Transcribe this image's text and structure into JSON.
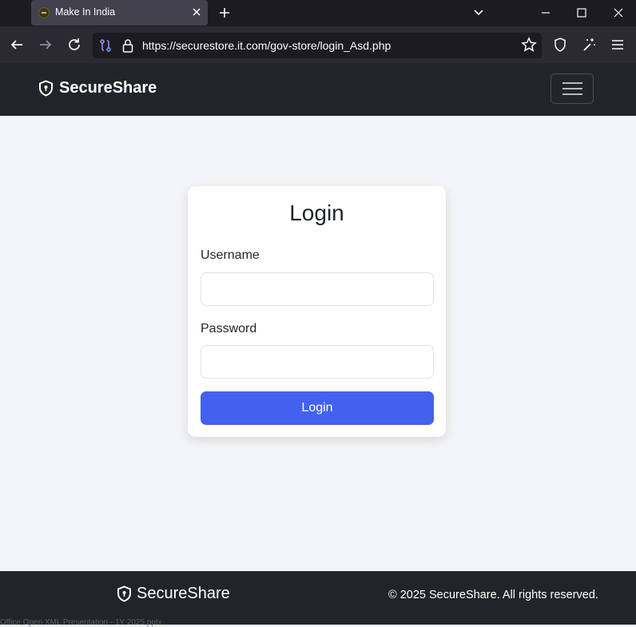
{
  "browser": {
    "tab_title": "Make In India",
    "url": "https://securestore.it.com/gov-store/login_Asd.php"
  },
  "header": {
    "brand": "SecureShare"
  },
  "login": {
    "title": "Login",
    "username_label": "Username",
    "username_value": "",
    "password_label": "Password",
    "password_value": "",
    "submit_label": "Login"
  },
  "footer": {
    "brand": "SecureShare",
    "copyright": "© 2025 SecureShare. All rights reserved.",
    "underlying_text": "Office Open XML Presentation - 1Y 2025.pptx"
  },
  "colors": {
    "header_bg": "#212529",
    "accent": "#4361ee",
    "page_bg": "#f4f5f8"
  }
}
